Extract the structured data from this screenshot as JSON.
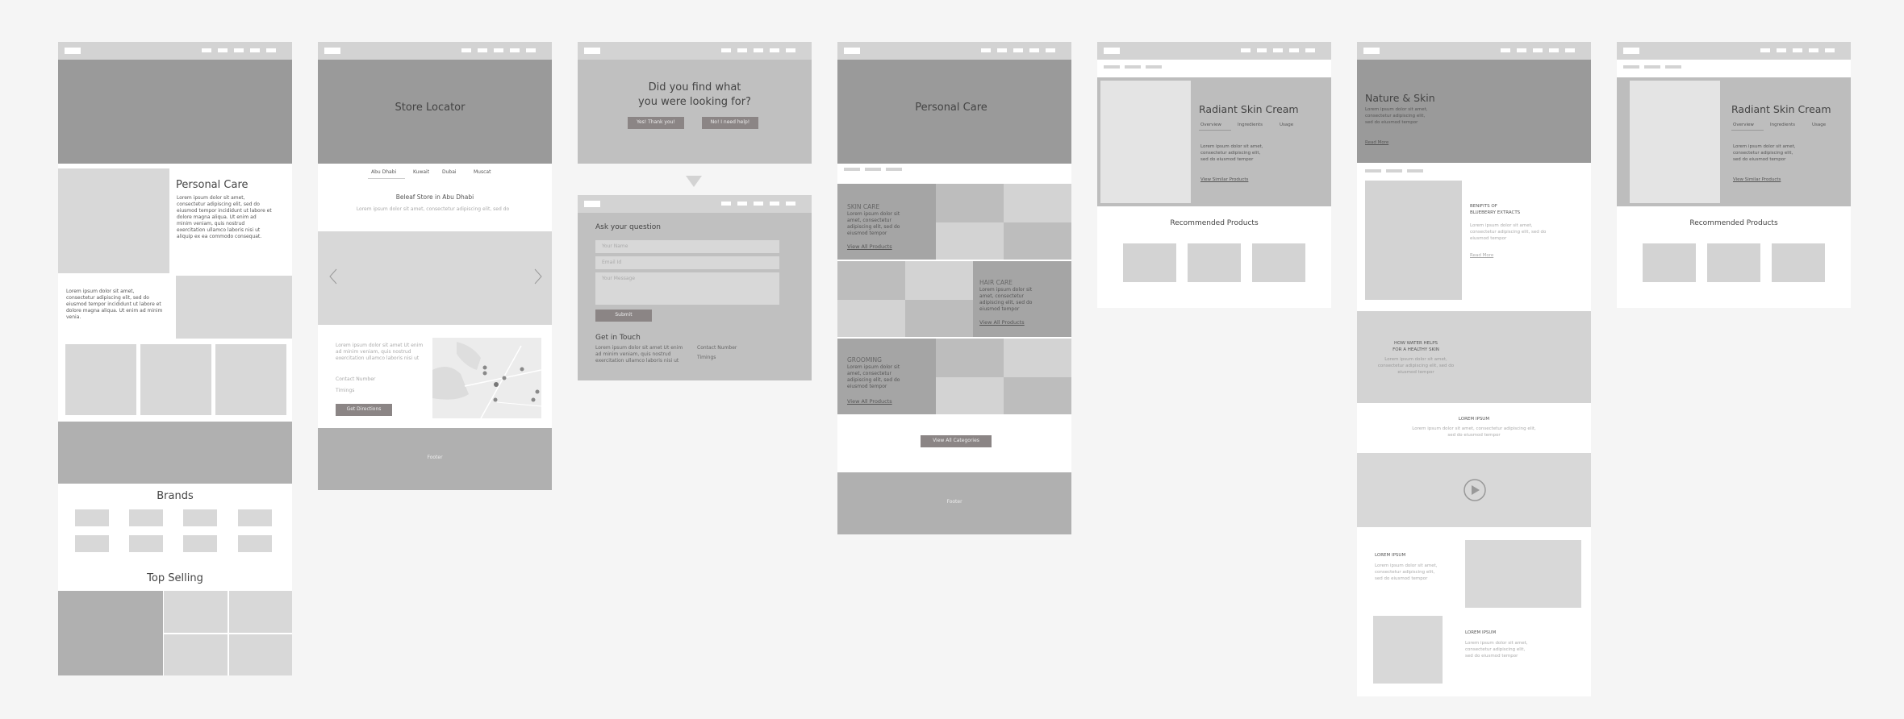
{
  "colors": {
    "page_bg": "#f5f5f5",
    "nav_bg": "#d3d3d3",
    "hero_dark": "#9a9a9a",
    "hero_mid": "#c0c0c0",
    "block_light": "#d8d8d8",
    "block_mid": "#b0b0b0",
    "button": "#8b8585"
  },
  "home": {
    "feature_title": "Personal Care",
    "feature_text": "Lorem ipsum dolor sit amet, consectetur adipiscing elit, sed do eiusmod tempor incididunt ut labore et dolore magna aliqua. Ut enim ad minim veniam, quis nostrud exercitation ullamco laboris nisi ut aliquip ex ea commodo consequat.",
    "second_text": "Lorem ipsum dolor sit amet, consectetur adipiscing elit, sed do eiusmod tempor incididunt ut labore et dolore magna aliqua. Ut enim ad minim venia.",
    "brands_title": "Brands",
    "top_selling_title": "Top Selling"
  },
  "store_locator": {
    "hero_title": "Store Locator",
    "tabs": [
      {
        "label": "Abu Dhabi",
        "active": true
      },
      {
        "label": "Kuwait"
      },
      {
        "label": "Dubai"
      },
      {
        "label": "Muscat"
      }
    ],
    "store_title": "Beleaf Store in Abu Dhabi",
    "store_subtitle": "Lorem ipsum dolor sit amet, consectetur adipiscing elit, sed do",
    "details_text": "Lorem ipsum dolor sit amet  Ut enim ad minim veniam, quis nostrud exercitation ullamco laboris nisi ut",
    "contact_label": "Contact Number",
    "timings_label": "Timings",
    "directions_button": "Get Directions",
    "footer": "Footer"
  },
  "feedback": {
    "question": "Did you find what you were looking for?",
    "question_line1": "Did you find what",
    "question_line2": "you were looking for?",
    "yes_button": "Yes! Thank you!",
    "no_button": "No! I need help!",
    "form_title": "Ask your question",
    "name_placeholder": "Your Name",
    "email_placeholder": "Email Id",
    "message_placeholder": "Your Message",
    "submit_button": "Submit",
    "contact_title": "Get in Touch",
    "contact_text": "Lorem ipsum dolor sit amet  Ut enim ad minim veniam, quis nostrud exercitation ullamco laboris nisi ut",
    "contact_label": "Contact Number",
    "timings_label": "Timings"
  },
  "category": {
    "hero_title": "Personal Care",
    "sections": [
      {
        "title": "SKIN CARE",
        "text": "Lorem ipsum dolor sit amet, consectetur adipiscing elit, sed do eiusmod tempor",
        "link": "View All Products"
      },
      {
        "title": "HAIR CARE",
        "text": "Lorem ipsum dolor sit amet, consectetur adipiscing elit, sed do eiusmod tempor",
        "link": "View All Products"
      },
      {
        "title": "GROOMING",
        "text": "Lorem ipsum dolor sit amet, consectetur adipiscing elit, sed do eiusmod tempor",
        "link": "View All Products"
      }
    ],
    "all_categories_button": "View All Categories",
    "footer": "Footer"
  },
  "product_a": {
    "title": "Radiant Skin Cream",
    "tabs": [
      {
        "label": "Overview",
        "active": true
      },
      {
        "label": "Ingredients"
      },
      {
        "label": "Usage"
      }
    ],
    "text": "Lorem ipsum dolor sit amet, consectetur adipiscing elit, sed do eiusmod tempor",
    "link": "View Similar Products",
    "recommended_title": "Recommended Products"
  },
  "blog": {
    "hero_title": "Nature & Skin",
    "hero_text": "Lorem ipsum dolor sit amet, consectetur adipiscing elit, sed do eiusmod tempor",
    "hero_link": "Read More",
    "article_title_1": "BENIFITS OF",
    "article_title_2": "BLUEBERRY EXTRACTS",
    "article_text": "Lorem ipsum dolor sit amet, consectetur adipiscing elit, sed do eiusmod tempor",
    "article_link": "Read More",
    "water_title_1": "HOW WATER HELPS",
    "water_title_2": "FOR A HEALTHY SKIN",
    "water_text": "Lorem ipsum dolor sit amet, consectetur adipiscing elit, sed do eiusmod tempor",
    "lorem_title": "LOREM IPSUM",
    "lorem_text": "Lorem ipsum dolor sit amet, consectetur adipiscing elit, sed do eiusmod tempor",
    "row1_title": "LOREM IPSUM",
    "row1_text": "Lorem ipsum dolor sit amet, consectetur adipiscing elit, sed do eiusmod tempor",
    "row2_title": "LOREM IPSUM",
    "row2_text": "Lorem ipsum dolor sit amet, consectetur adipiscing elit, sed do eiusmod tempor"
  },
  "product_b": {
    "title": "Radiant Skin Cream",
    "tabs": [
      {
        "label": "Overview",
        "active": true
      },
      {
        "label": "Ingredients"
      },
      {
        "label": "Usage"
      }
    ],
    "text": "Lorem ipsum dolor sit amet, consectetur adipiscing elit, sed do eiusmod tempor",
    "link": "View Similar Products",
    "recommended_title": "Recommended Products"
  }
}
